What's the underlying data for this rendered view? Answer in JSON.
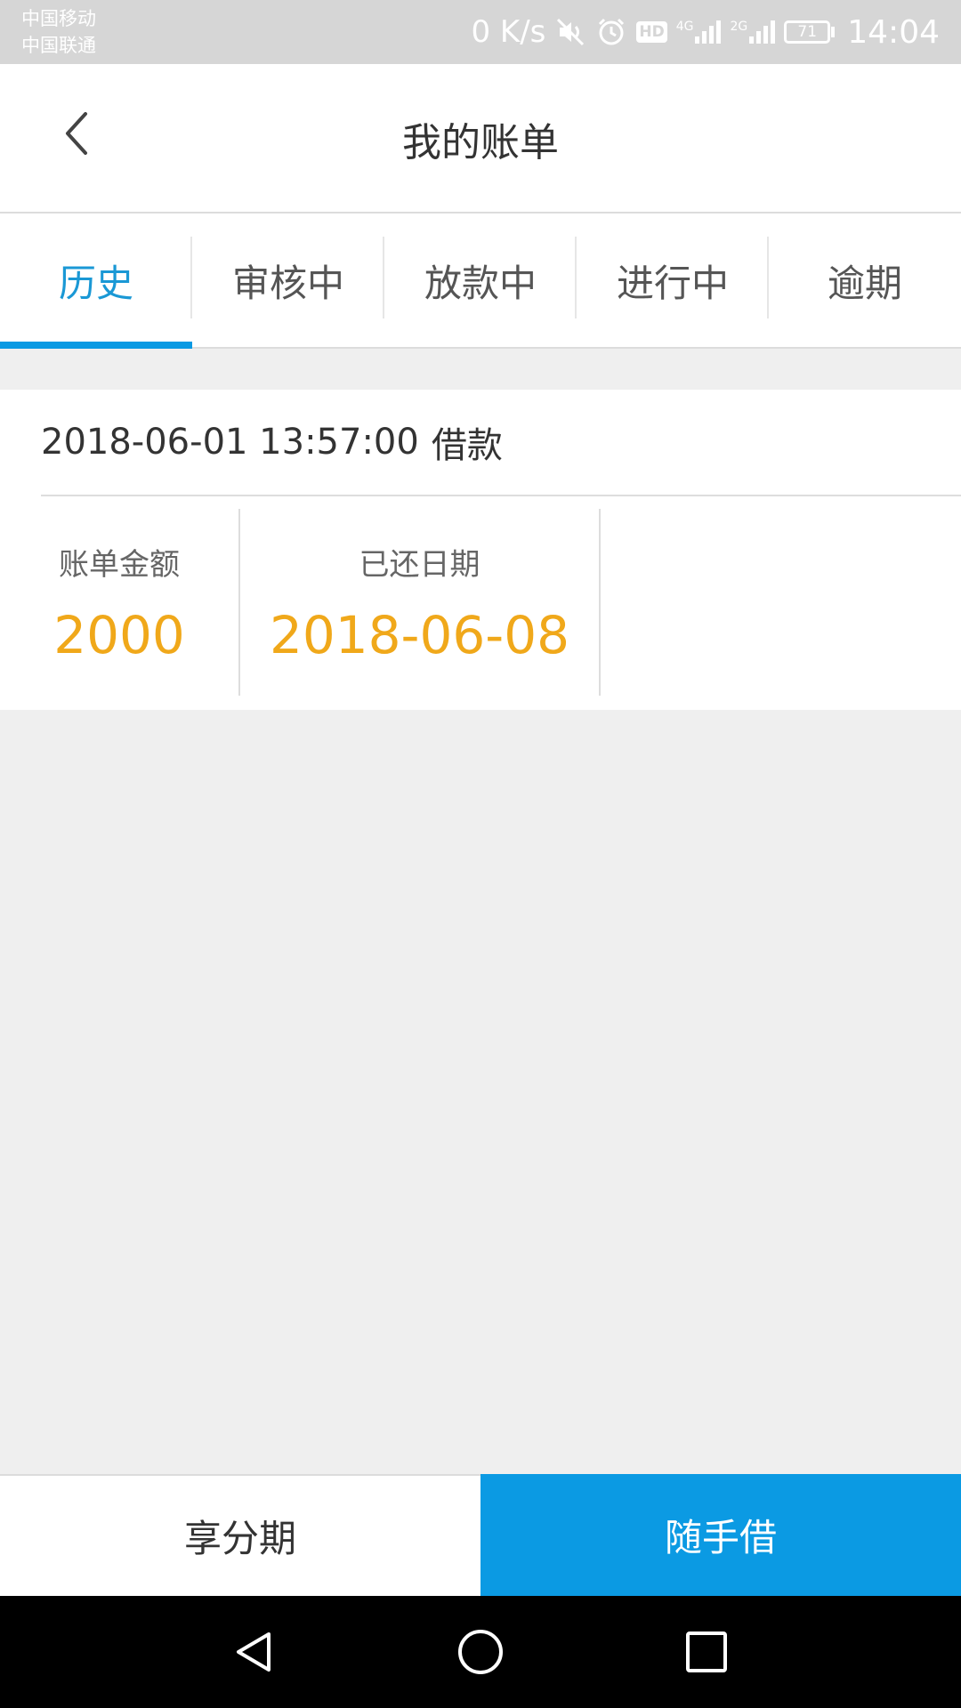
{
  "status_bar": {
    "carrier_1": "中国移动",
    "carrier_2": "中国联通",
    "net_speed": "0 K/s",
    "hd_badge": "HD",
    "net_type_1": "4G",
    "net_type_2": "2G",
    "battery_level": "71",
    "time": "14:04",
    "icons": [
      "mute-icon",
      "alarm-icon",
      "hd-icon",
      "signal-4g-icon",
      "signal-2g-icon",
      "battery-icon"
    ]
  },
  "header": {
    "title": "我的账单",
    "back_icon": "chevron-left-icon"
  },
  "tabs": [
    {
      "label": "历史",
      "active": true
    },
    {
      "label": "审核中",
      "active": false
    },
    {
      "label": "放款中",
      "active": false
    },
    {
      "label": "进行中",
      "active": false
    },
    {
      "label": "逾期",
      "active": false
    }
  ],
  "bill": {
    "datetime": "2018-06-01 13:57:00",
    "type": "借款",
    "amount_label": "账单金额",
    "amount_value": "2000",
    "repaid_date_label": "已还日期",
    "repaid_date_value": "2018-06-08"
  },
  "bottom_actions": {
    "installment_label": "享分期",
    "borrow_label": "随手借"
  },
  "nav_bar": {
    "icons": [
      "back-triangle-icon",
      "home-circle-icon",
      "recents-square-icon"
    ]
  },
  "colors": {
    "accent_blue": "#0b9ae3",
    "active_tab_text": "#1a98d5",
    "value_orange": "#f0a81a",
    "status_bar_bg": "#d6d6d6",
    "page_bg": "#efefef"
  }
}
